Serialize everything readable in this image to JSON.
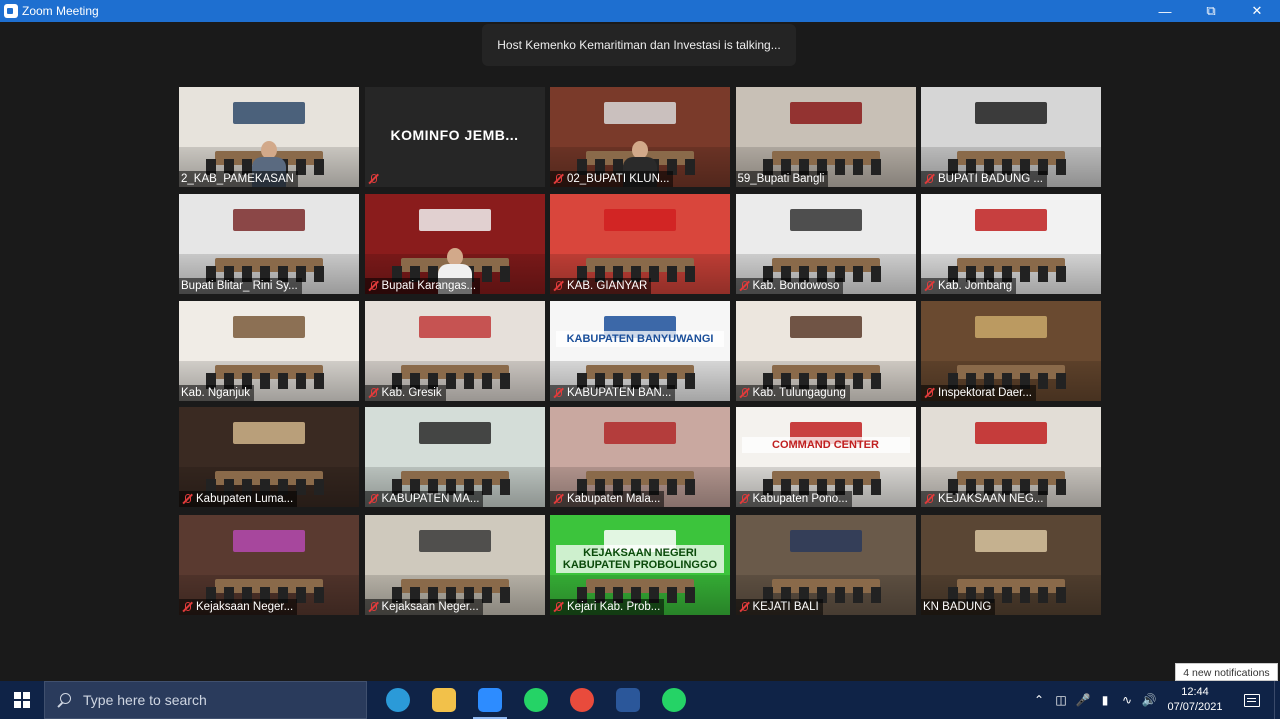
{
  "window": {
    "title": "Zoom Meeting",
    "icon": "zoom-icon",
    "controls": [
      "minimize",
      "maximize",
      "close"
    ]
  },
  "banner": {
    "talking": "Host Kemenko Kemaritiman dan Investasi is talking..."
  },
  "participants": [
    {
      "name": "2_KAB_PAMEKASAN",
      "muted": false,
      "wall": "#e7e3dc",
      "accent": "#2f4a6a"
    },
    {
      "name": "",
      "center_name": "KOMINFO  JEMB...",
      "muted": true,
      "dark": true
    },
    {
      "name": "02_BUPATI KLUN...",
      "muted": true,
      "wall": "#7a3a2a",
      "accent": "#d8d8d8"
    },
    {
      "name": "59_Bupati Bangli",
      "muted": false,
      "wall": "#c8c0b6",
      "accent": "#8a1a1a"
    },
    {
      "name": "BUPATI BADUNG ...",
      "muted": true,
      "wall": "#d6d6d6",
      "accent": "#202020"
    },
    {
      "name": "Bupati Blitar_ Rini Sy...",
      "muted": false,
      "wall": "#e6e6e6",
      "accent": "#7a2a2a"
    },
    {
      "name": "Bupati Karangas...",
      "muted": true,
      "wall": "#8a1c1c",
      "accent": "#f0f0f0"
    },
    {
      "name": "KAB. GIANYAR",
      "muted": true,
      "wall": "#d9463c",
      "accent": "#d02020"
    },
    {
      "name": "Kab. Bondowoso",
      "muted": true,
      "wall": "#ebebeb",
      "accent": "#333333"
    },
    {
      "name": "Kab. Jombang",
      "muted": true,
      "wall": "#f2f2f2",
      "accent": "#c02020"
    },
    {
      "name": "Kab. Nganjuk",
      "muted": false,
      "wall": "#f0ece6",
      "accent": "#7a5a3a"
    },
    {
      "name": "Kab. Gresik",
      "muted": true,
      "wall": "#e6e0da",
      "accent": "#c03a3a"
    },
    {
      "name": "KABUPATEN BAN...",
      "muted": true,
      "wall": "#f6f6f6",
      "accent": "#1b4f9a",
      "sign": "KABUPATEN BANYUWANGI"
    },
    {
      "name": "Kab. Tulungagung",
      "muted": true,
      "wall": "#ece6de",
      "accent": "#5a3a2a"
    },
    {
      "name": "Inspektorat Daer...",
      "muted": true,
      "wall": "#6a4a30",
      "accent": "#c9a86a"
    },
    {
      "name": "Kabupaten Luma...",
      "muted": true,
      "wall": "#3a2a22",
      "accent": "#d0b48a"
    },
    {
      "name": "KABUPATEN MA...",
      "muted": true,
      "wall": "#d4ddd8",
      "accent": "#2a2a2a"
    },
    {
      "name": "Kabupaten Mala...",
      "muted": true,
      "wall": "#c9a8a0",
      "accent": "#b02a2a"
    },
    {
      "name": "Kabupaten Pono...",
      "muted": true,
      "wall": "#f4f2ee",
      "accent": "#c02020",
      "sign": "COMMAND CENTER"
    },
    {
      "name": "KEJAKSAAN NEG...",
      "muted": true,
      "wall": "#e2ddd6",
      "accent": "#c02020"
    },
    {
      "name": "Kejaksaan Neger...",
      "muted": true,
      "wall": "#5a3a30",
      "accent": "#b54ab0"
    },
    {
      "name": "Kejaksaan Neger...",
      "muted": true,
      "wall": "#cfc9bd",
      "accent": "#3a3a3a"
    },
    {
      "name": "Kejari Kab. Prob...",
      "muted": true,
      "wall": "#3cc43c",
      "accent": "#ffffff",
      "sign": "KEJAKSAAN NEGERI KABUPATEN PROBOLINGGO"
    },
    {
      "name": "KEJATI BALI",
      "muted": true,
      "wall": "#6a5a4a",
      "accent": "#2a3a5a"
    },
    {
      "name": "KN BADUNG",
      "muted": false,
      "wall": "#5a4634",
      "accent": "#d8c4a0"
    }
  ],
  "notification": "4 new notifications",
  "taskbar": {
    "search_placeholder": "Type here to search",
    "apps": [
      {
        "name": "edge-icon",
        "color": "#2b9ad8"
      },
      {
        "name": "file-explorer-icon",
        "color": "#f2c14a"
      },
      {
        "name": "zoom-icon",
        "color": "#2d8cff"
      },
      {
        "name": "whatsapp-icon",
        "color": "#25d366"
      },
      {
        "name": "chrome-icon",
        "color": "#e94b3c"
      },
      {
        "name": "word-icon",
        "color": "#2b579a"
      },
      {
        "name": "whatsapp-icon",
        "color": "#25d366"
      }
    ],
    "time": "12:44",
    "date": "07/07/2021"
  }
}
